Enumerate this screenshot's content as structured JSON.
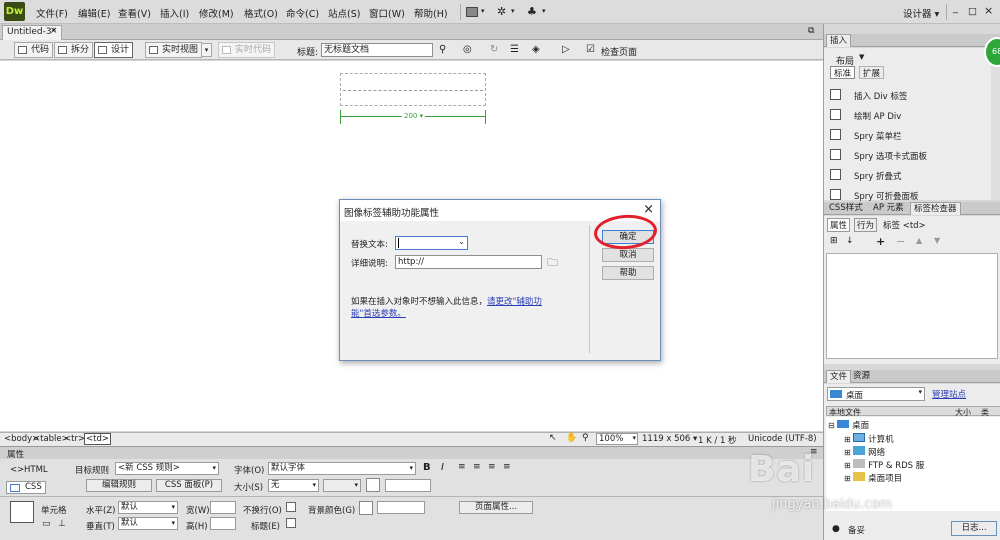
{
  "app": {
    "logo": "Dw"
  },
  "menubar": {
    "items": [
      "文件(F)",
      "编辑(E)",
      "查看(V)",
      "插入(I)",
      "修改(M)",
      "格式(O)",
      "命令(C)",
      "站点(S)",
      "窗口(W)",
      "帮助(H)"
    ],
    "workspace": "设计器 ▾",
    "window_controls": [
      "_",
      "□",
      "×"
    ]
  },
  "document": {
    "tab": "Untitled-3*"
  },
  "toolbar": {
    "code": "代码",
    "split": "拆分",
    "design": "设计",
    "live_view": "实时视图",
    "live_code": "实时代码",
    "title_label": "标题:",
    "title_value": "无标题文档",
    "check_page": "检查页面"
  },
  "canvas": {
    "width_label": "200 ▾"
  },
  "dialog": {
    "title": "图像标签辅助功能属性",
    "alt_label": "替换文本:",
    "longdesc_label": "详细说明:",
    "longdesc_value": "http://",
    "ok": "确定",
    "cancel": "取消",
    "help": "帮助",
    "info_text": "如果在插入对象时不想输入此信息，",
    "info_link_1": "请更改\"辅助功",
    "info_link_2": "能\"首选参数。"
  },
  "statusbar": {
    "tags": [
      "<body>",
      "<table>",
      "<tr>",
      "<td>"
    ],
    "zoom": "100%",
    "dims": "1119 x 506 ▾",
    "size_time": "1 K / 1 秒",
    "encoding": "Unicode (UTF-8)"
  },
  "properties": {
    "header": "属性",
    "html": "HTML",
    "css": "CSS",
    "target_rule_label": "目标规则",
    "target_rule_value": "<新 CSS 规则>",
    "edit_rule": "编辑规则",
    "css_panel": "CSS 面板(P)",
    "font_label": "字体(O)",
    "font_value": "默认字体",
    "size_label": "大小(S)",
    "size_value": "无",
    "cell_label": "单元格",
    "horz_label": "水平(Z)",
    "horz_value": "默认",
    "vert_label": "垂直(T)",
    "vert_value": "默认",
    "width_label": "宽(W)",
    "height_label": "高(H)",
    "nowrap_label": "不换行(O)",
    "header_label": "标题(E)",
    "bg_label": "背景颜色(G)",
    "page_props": "页面属性..."
  },
  "insert_panel": {
    "tab": "插入",
    "category": "布局",
    "btn_standard": "标准",
    "btn_expanded": "扩展",
    "items": [
      "插入 Div 标签",
      "绘制 AP Div",
      "Spry 菜单栏",
      "Spry 选项卡式面板",
      "Spry 折叠式",
      "Spry 可折叠面板"
    ]
  },
  "css_panel": {
    "tabs": [
      "CSS样式",
      "AP 元素",
      "标签检查器"
    ],
    "subtabs": [
      "属性",
      "行为"
    ],
    "tag": "标签 <td>"
  },
  "files_panel": {
    "tabs": [
      "文件",
      "资源"
    ],
    "location": "桌面",
    "manage": "管理站点",
    "col_local": "本地文件",
    "col_size": "大小",
    "col_type": "类",
    "tree": [
      "桌面",
      "计算机",
      "网络",
      "FTP & RDS 服",
      "桌面项目"
    ],
    "bottom_label": "备妥",
    "log_button": "日志..."
  },
  "watermark": {
    "brand": "Bai",
    "url": "jingyan.baidu.com"
  },
  "badge": "68"
}
